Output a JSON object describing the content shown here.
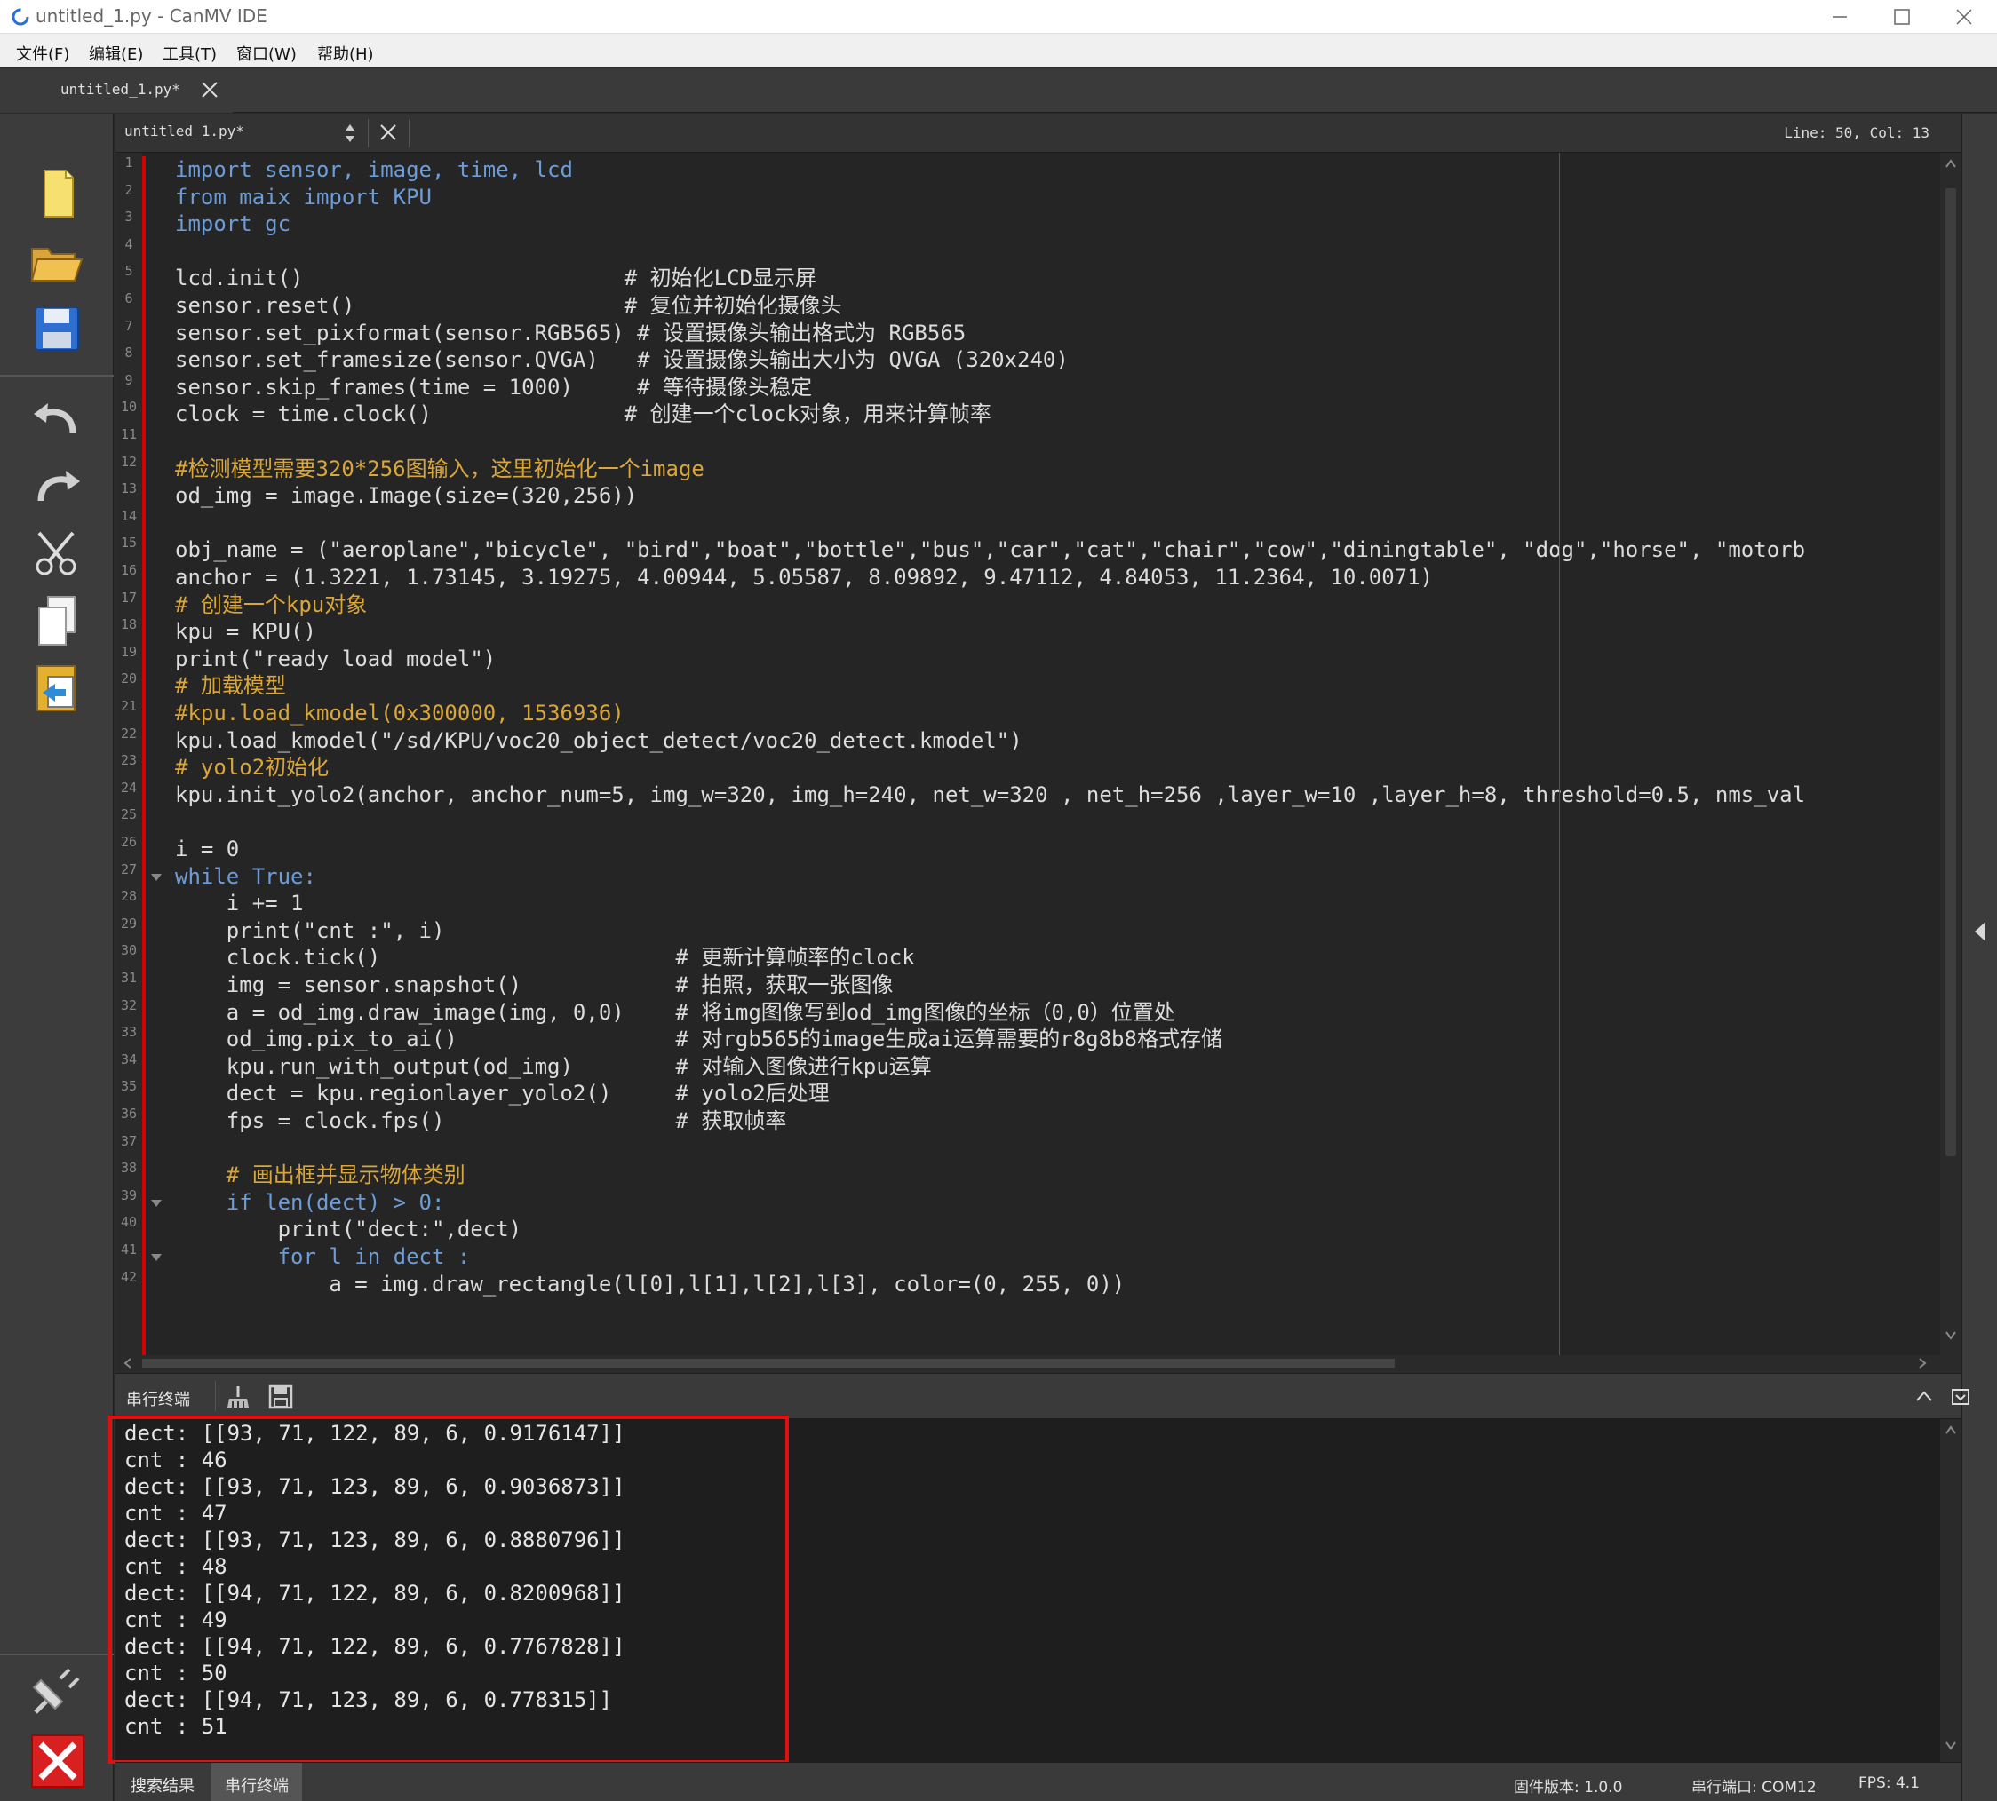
{
  "window": {
    "title": "untitled_1.py - CanMV IDE"
  },
  "menu": [
    "文件(F)",
    "编辑(E)",
    "工具(T)",
    "窗口(W)",
    "帮助(H)"
  ],
  "outer_tab": {
    "label": "untitled_1.py*"
  },
  "editor_header": {
    "file": "untitled_1.py*",
    "position": "Line: 50, Col: 13"
  },
  "code_lines": [
    {
      "n": "1",
      "text": "import sensor, image, time, lcd"
    },
    {
      "n": "2",
      "text": "from maix import KPU"
    },
    {
      "n": "3",
      "text": "import gc"
    },
    {
      "n": "4",
      "text": ""
    },
    {
      "n": "5",
      "text": "lcd.init()                         # 初始化LCD显示屏"
    },
    {
      "n": "6",
      "text": "sensor.reset()                     # 复位并初始化摄像头"
    },
    {
      "n": "7",
      "text": "sensor.set_pixformat(sensor.RGB565) # 设置摄像头输出格式为 RGB565"
    },
    {
      "n": "8",
      "text": "sensor.set_framesize(sensor.QVGA)   # 设置摄像头输出大小为 QVGA (320x240)"
    },
    {
      "n": "9",
      "text": "sensor.skip_frames(time = 1000)     # 等待摄像头稳定"
    },
    {
      "n": "10",
      "text": "clock = time.clock()               # 创建一个clock对象，用来计算帧率"
    },
    {
      "n": "11",
      "text": ""
    },
    {
      "n": "12",
      "text": "#检测模型需要320*256图输入，这里初始化一个image"
    },
    {
      "n": "13",
      "text": "od_img = image.Image(size=(320,256))"
    },
    {
      "n": "14",
      "text": ""
    },
    {
      "n": "15",
      "text": "obj_name = (\"aeroplane\",\"bicycle\", \"bird\",\"boat\",\"bottle\",\"bus\",\"car\",\"cat\",\"chair\",\"cow\",\"diningtable\", \"dog\",\"horse\", \"motorb"
    },
    {
      "n": "16",
      "text": "anchor = (1.3221, 1.73145, 3.19275, 4.00944, 5.05587, 8.09892, 9.47112, 4.84053, 11.2364, 10.0071)"
    },
    {
      "n": "17",
      "text": "# 创建一个kpu对象"
    },
    {
      "n": "18",
      "text": "kpu = KPU()"
    },
    {
      "n": "19",
      "text": "print(\"ready load model\")"
    },
    {
      "n": "20",
      "text": "# 加载模型"
    },
    {
      "n": "21",
      "text": "#kpu.load_kmodel(0x300000, 1536936)"
    },
    {
      "n": "22",
      "text": "kpu.load_kmodel(\"/sd/KPU/voc20_object_detect/voc20_detect.kmodel\")"
    },
    {
      "n": "23",
      "text": "# yolo2初始化"
    },
    {
      "n": "24",
      "text": "kpu.init_yolo2(anchor, anchor_num=5, img_w=320, img_h=240, net_w=320 , net_h=256 ,layer_w=10 ,layer_h=8, threshold=0.5, nms_val"
    },
    {
      "n": "25",
      "text": ""
    },
    {
      "n": "26",
      "text": "i = 0"
    },
    {
      "n": "27",
      "text": "while True:"
    },
    {
      "n": "28",
      "text": "    i += 1"
    },
    {
      "n": "29",
      "text": "    print(\"cnt :\", i)"
    },
    {
      "n": "30",
      "text": "    clock.tick()                       # 更新计算帧率的clock"
    },
    {
      "n": "31",
      "text": "    img = sensor.snapshot()            # 拍照，获取一张图像"
    },
    {
      "n": "32",
      "text": "    a = od_img.draw_image(img, 0,0)    # 将img图像写到od_img图像的坐标（0,0）位置处"
    },
    {
      "n": "33",
      "text": "    od_img.pix_to_ai()                 # 对rgb565的image生成ai运算需要的r8g8b8格式存储"
    },
    {
      "n": "34",
      "text": "    kpu.run_with_output(od_img)        # 对输入图像进行kpu运算"
    },
    {
      "n": "35",
      "text": "    dect = kpu.regionlayer_yolo2()     # yolo2后处理"
    },
    {
      "n": "36",
      "text": "    fps = clock.fps()                  # 获取帧率"
    },
    {
      "n": "37",
      "text": ""
    },
    {
      "n": "38",
      "text": "    # 画出框并显示物体类别"
    },
    {
      "n": "39",
      "text": "    if len(dect) > 0:"
    },
    {
      "n": "40",
      "text": "        print(\"dect:\",dect)"
    },
    {
      "n": "41",
      "text": "        for l in dect :"
    },
    {
      "n": "42",
      "text": "            a = img.draw_rectangle(l[0],l[1],l[2],l[3], color=(0, 255, 0))"
    }
  ],
  "terminal": {
    "title": "串行终端",
    "lines": [
      "dect: [[93, 71, 122, 89, 6, 0.9176147]]",
      "cnt : 46",
      "dect: [[93, 71, 123, 89, 6, 0.9036873]]",
      "cnt : 47",
      "dect: [[93, 71, 123, 89, 6, 0.8880796]]",
      "cnt : 48",
      "dect: [[94, 71, 122, 89, 6, 0.8200968]]",
      "cnt : 49",
      "dect: [[94, 71, 122, 89, 6, 0.7767828]]",
      "cnt : 50",
      "dect: [[94, 71, 123, 89, 6, 0.778315]]",
      "cnt : 51"
    ]
  },
  "status": {
    "tab_search": "搜索结果",
    "tab_serial": "串行终端",
    "firmware": "固件版本: 1.0.0",
    "port": "串行端口: COM12",
    "fps": "FPS:  4.1"
  },
  "icons": {
    "toolbar": [
      "new-file-icon",
      "open-folder-icon",
      "save-icon",
      "undo-icon",
      "redo-icon",
      "cut-icon",
      "copy-icon",
      "paste-icon",
      "connect-icon",
      "disconnect-icon"
    ]
  },
  "colors": {
    "keyword": "#6d9cd6",
    "comment": "#d9a63c",
    "text": "#dcdcdc",
    "highlight_border": "#e01010"
  }
}
